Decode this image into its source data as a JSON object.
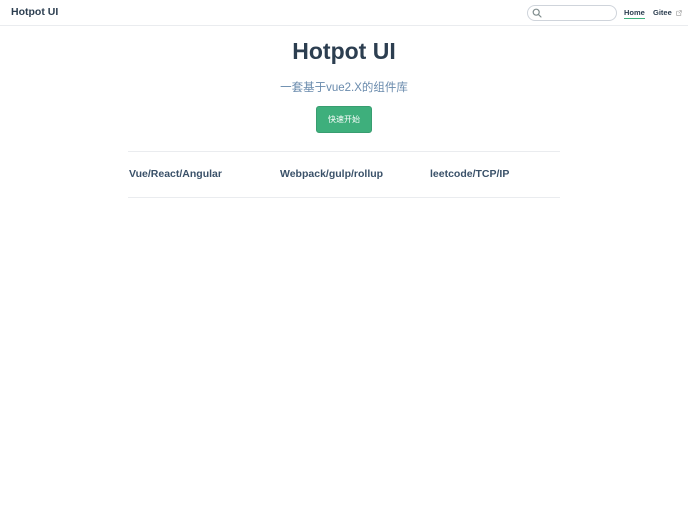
{
  "navbar": {
    "site_name": "Hotpot UI",
    "search": {
      "placeholder": "",
      "value": ""
    },
    "links": [
      {
        "label": "Home",
        "active": true
      },
      {
        "label": "Gitee",
        "external": true
      }
    ]
  },
  "hero": {
    "title": "Hotpot UI",
    "description": "一套基于vue2.X的组件库",
    "action_label": "快速开始"
  },
  "features": [
    {
      "title": "Vue/React/Angular"
    },
    {
      "title": "Webpack/gulp/rollup"
    },
    {
      "title": "leetcode/TCP/IP"
    }
  ],
  "colors": {
    "accent": "#3eaf7c",
    "text": "#2c3e50",
    "description": "#6a8bad",
    "border": "#eaecef"
  }
}
